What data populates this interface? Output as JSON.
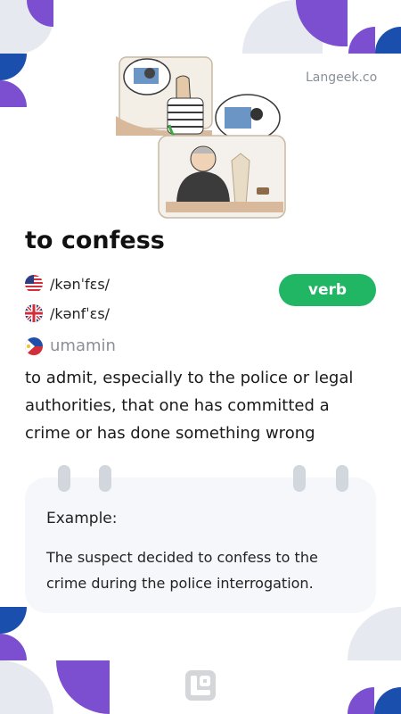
{
  "brand": {
    "site": "Langeek.co"
  },
  "illustration": {
    "icon": "confession-scene-illustration"
  },
  "word": {
    "title": "to confess",
    "part_of_speech": "verb",
    "pronunciations": [
      {
        "accent": "us-flag-icon",
        "ipa": "/kənˈfɛs/"
      },
      {
        "accent": "uk-flag-icon",
        "ipa": "/kənfˈɛs/"
      }
    ],
    "translation": {
      "language": "philippines-flag-icon",
      "text": "umamin"
    },
    "definition": "to admit, especially to the police or legal authorities, that one has committed a crime or has done something wrong"
  },
  "example": {
    "label": "Example:",
    "text": "The suspect decided to confess to the crime during the police interrogation."
  },
  "colors": {
    "accent_purple": "#7b4fcf",
    "accent_blue": "#1a4fad",
    "accent_green": "#21b663",
    "light_gray": "#e6e9ef",
    "card_bg": "#f5f7fb"
  }
}
